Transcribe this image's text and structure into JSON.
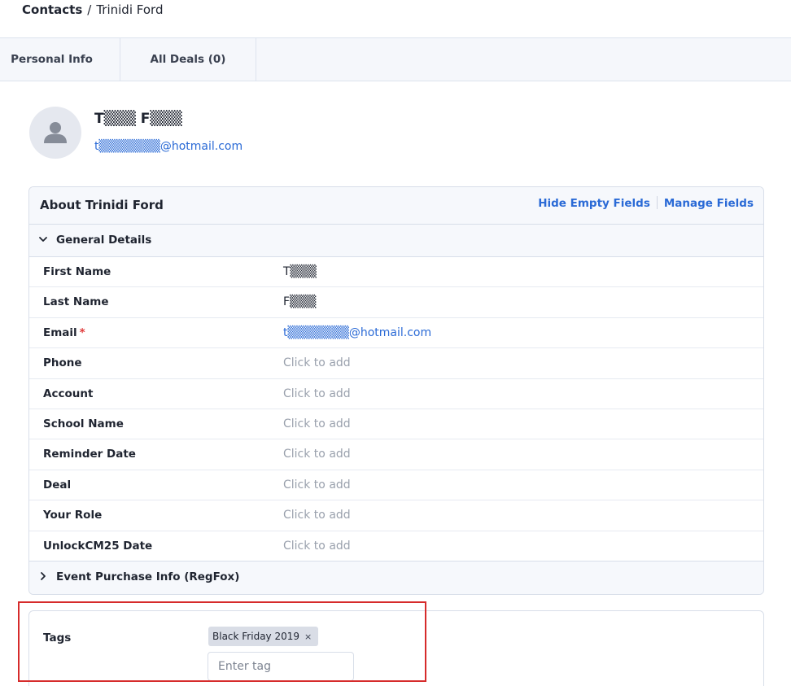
{
  "breadcrumb": {
    "root": "Contacts",
    "separator": "/",
    "current": "Trinidi Ford"
  },
  "tabs": [
    {
      "label": "Personal Info"
    },
    {
      "label": "All Deals (0)"
    }
  ],
  "profile": {
    "name": "T▒▒▒ F▒▒▒",
    "email": "t▒▒▒▒▒▒▒@hotmail.com"
  },
  "about": {
    "title": "About Trinidi Ford",
    "hide_empty": "Hide Empty Fields",
    "manage_fields": "Manage Fields",
    "general_section": "General Details",
    "event_section": "Event Purchase Info (RegFox)",
    "fields": [
      {
        "name": "First Name",
        "value": "T▒▒▒",
        "required": ""
      },
      {
        "name": "Last Name",
        "value": "F▒▒▒",
        "required": ""
      },
      {
        "name": "Email",
        "value": "t▒▒▒▒▒▒▒@hotmail.com",
        "required": "*"
      },
      {
        "name": "Phone",
        "value": "Click to add",
        "required": ""
      },
      {
        "name": "Account",
        "value": "Click to add",
        "required": ""
      },
      {
        "name": "School Name",
        "value": "Click to add",
        "required": ""
      },
      {
        "name": "Reminder Date",
        "value": "Click to add",
        "required": ""
      },
      {
        "name": "Deal",
        "value": "Click to add",
        "required": ""
      },
      {
        "name": "Your Role",
        "value": "Click to add",
        "required": ""
      },
      {
        "name": "UnlockCM25 Date",
        "value": "Click to add",
        "required": ""
      }
    ]
  },
  "tags": {
    "label": "Tags",
    "items": [
      {
        "label": "Black Friday 2019",
        "remove": "×"
      }
    ],
    "input_placeholder": "Enter tag"
  },
  "colors": {
    "accent": "#2a6ad6",
    "required": "#e03a3a",
    "highlight": "#d62b2b"
  }
}
